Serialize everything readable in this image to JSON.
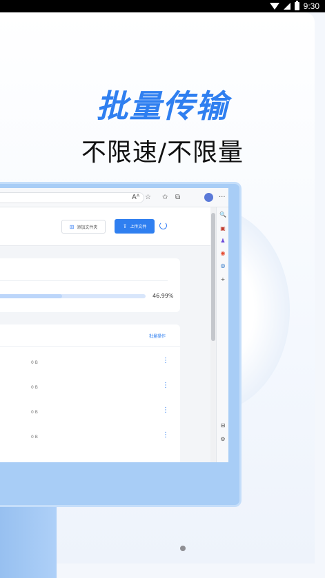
{
  "status_bar": {
    "time": "9:30",
    "icons": [
      "wifi-icon",
      "signal-icon",
      "battery-icon"
    ]
  },
  "hero": {
    "headline": "批量传输",
    "subheadline": "不限速/不限量"
  },
  "browser": {
    "toolbar_icons": [
      "read-aloud-icon",
      "favorite-add-icon",
      "favorites-icon",
      "collections-icon",
      "profile-avatar",
      "more-icon"
    ],
    "toolbar_glyphs": {
      "read_aloud": "Aᴬ",
      "favorite_add": "☆",
      "favorites": "✩",
      "collections": "⧉",
      "more": "···"
    },
    "sidebar_icons": [
      "search-icon",
      "toolbox-icon",
      "games-icon",
      "office-icon",
      "outlook-icon",
      "add-icon",
      "split-screen-icon",
      "settings-icon"
    ],
    "sidebar_glyphs": {
      "search": "🔍",
      "toolbox": "▣",
      "games": "♟",
      "office": "◉",
      "outlook": "◎",
      "add": "+",
      "split": "⊟",
      "settings": "⚙"
    }
  },
  "file_page": {
    "add_folder_label": "添加文件夹",
    "upload_label": "上传文件",
    "progress_percent": 46.99,
    "progress_text": "46.99%",
    "batch_label": "批量操作",
    "rows": [
      {
        "size": "0 B",
        "more": "⋮"
      },
      {
        "size": "0 B",
        "more": "⋮"
      },
      {
        "size": "0 B",
        "more": "⋮"
      },
      {
        "size": "0 B",
        "more": "⋮"
      }
    ]
  },
  "colors": {
    "accent": "#2f7ff0",
    "monitor_frame": "#a8cdf6",
    "background": "#f4f7fc"
  }
}
